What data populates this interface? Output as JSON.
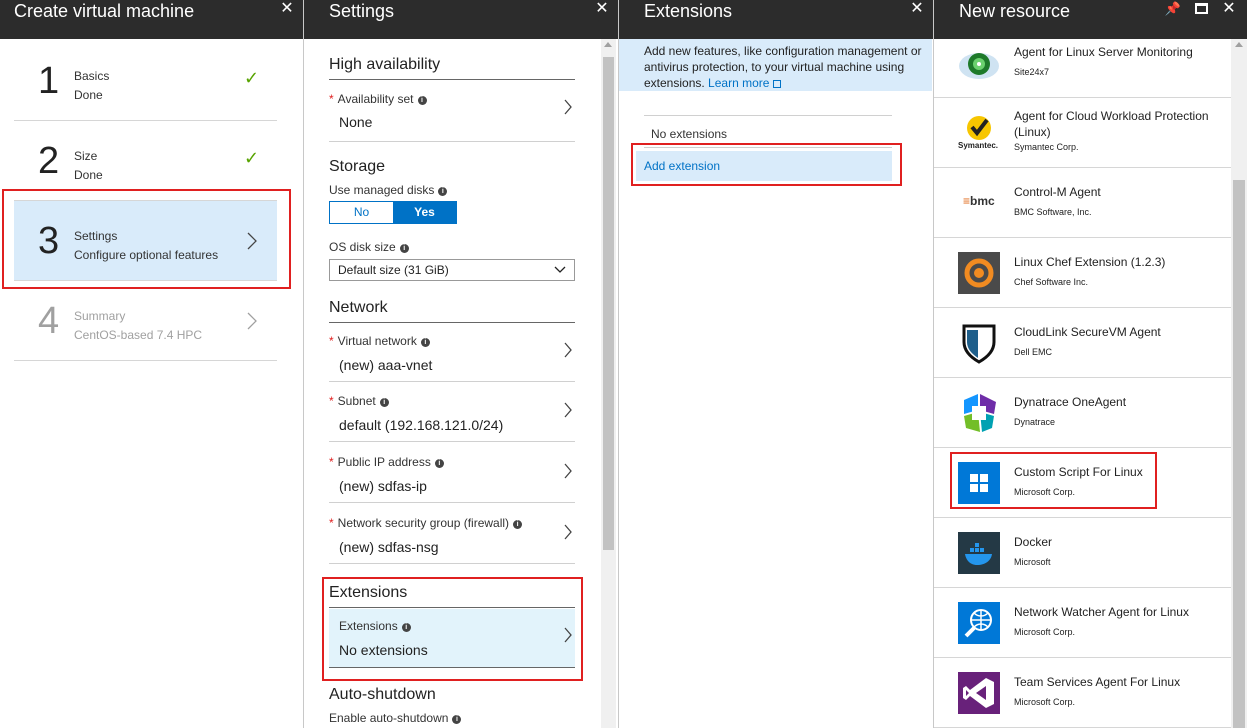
{
  "blade1": {
    "title": "Create virtual machine",
    "steps": [
      {
        "num": "1",
        "title": "Basics",
        "sub": "Done"
      },
      {
        "num": "2",
        "title": "Size",
        "sub": "Done"
      },
      {
        "num": "3",
        "title": "Settings",
        "sub": "Configure optional features"
      },
      {
        "num": "4",
        "title": "Summary",
        "sub": "CentOS-based 7.4 HPC"
      }
    ]
  },
  "blade2": {
    "title": "Settings",
    "ha": {
      "heading": "High availability",
      "avset_label": "Availability set",
      "avset_value": "None"
    },
    "storage": {
      "heading": "Storage",
      "managed_label": "Use managed disks",
      "no": "No",
      "yes": "Yes",
      "disk_label": "OS disk size",
      "disk_value": "Default size (31 GiB)"
    },
    "network": {
      "heading": "Network",
      "vnet_label": "Virtual network",
      "vnet_value": "(new) aaa-vnet",
      "subnet_label": "Subnet",
      "subnet_value": "default (192.168.121.0/24)",
      "pip_label": "Public IP address",
      "pip_value": "(new) sdfas-ip",
      "nsg_label": "Network security group (firewall)",
      "nsg_value": "(new) sdfas-nsg"
    },
    "extensions": {
      "heading": "Extensions",
      "label": "Extensions",
      "value": "No extensions"
    },
    "autoshutdown": {
      "heading": "Auto-shutdown",
      "label": "Enable auto-shutdown"
    }
  },
  "blade3": {
    "title": "Extensions",
    "info_text": "Add new features, like configuration management or antivirus protection, to your virtual machine using extensions.",
    "learn_more": "Learn more",
    "no_extensions": "No extensions",
    "add_extension": "Add extension"
  },
  "blade4": {
    "title": "New resource",
    "items": [
      {
        "name": "Agent for Linux Server Monitoring",
        "publisher": "Site24x7"
      },
      {
        "name": "Agent for Cloud Workload Protection (Linux)",
        "publisher": "Symantec Corp."
      },
      {
        "name": "Control-M Agent",
        "publisher": "BMC Software, Inc."
      },
      {
        "name": "Linux Chef Extension (1.2.3)",
        "publisher": "Chef Software Inc."
      },
      {
        "name": "CloudLink SecureVM Agent",
        "publisher": "Dell EMC"
      },
      {
        "name": "Dynatrace OneAgent",
        "publisher": "Dynatrace"
      },
      {
        "name": "Custom Script For Linux",
        "publisher": "Microsoft Corp."
      },
      {
        "name": "Docker",
        "publisher": "Microsoft"
      },
      {
        "name": "Network Watcher Agent for Linux",
        "publisher": "Microsoft Corp."
      },
      {
        "name": "Team Services Agent For Linux",
        "publisher": "Microsoft Corp."
      }
    ],
    "symantec_logo_text": "Symantec.",
    "bmc_logo_text": "bmc"
  },
  "colors": {
    "accent": "#0072c6",
    "highlight": "#d9ebfa",
    "header": "#2c2c2c",
    "success": "#57a300",
    "callout": "#e02020"
  }
}
